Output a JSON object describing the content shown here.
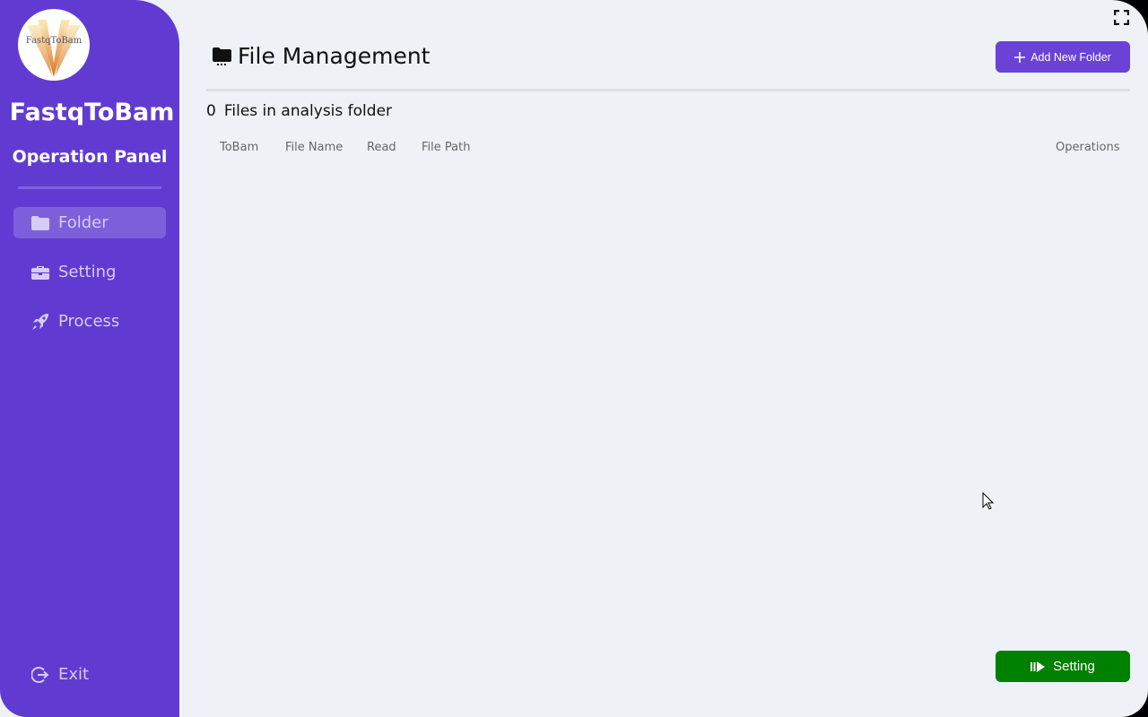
{
  "sidebar": {
    "logo_text": "FastqToBam",
    "app_title": "FastqToBam",
    "panel_title": "Operation Panel",
    "items": [
      {
        "label": "Folder",
        "icon": "folder-icon",
        "active": true
      },
      {
        "label": "Setting",
        "icon": "toolbox-icon",
        "active": false
      },
      {
        "label": "Process",
        "icon": "rocket-icon",
        "active": false
      }
    ],
    "exit_label": "Exit"
  },
  "main": {
    "title": "File Management",
    "add_folder_label": "Add New Folder",
    "file_count": "0",
    "file_count_label": "Files in analysis folder",
    "columns": [
      "ToBam",
      "File Name",
      "Read",
      "File Path",
      "Operations"
    ],
    "rows": [],
    "run_button_label": "Setting"
  },
  "colors": {
    "sidebar": "#613bd1",
    "accent": "#6a42d6",
    "run": "#008000",
    "background": "#eef2f7"
  }
}
